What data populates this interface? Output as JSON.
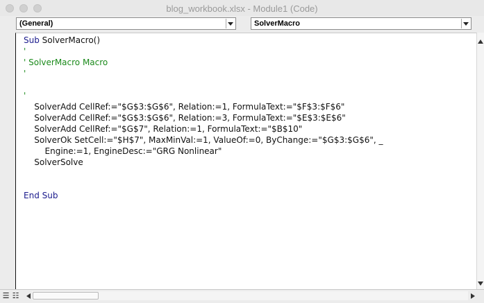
{
  "window": {
    "title": "blog_workbook.xlsx - Module1 (Code)"
  },
  "toolbar": {
    "object_dropdown": "(General)",
    "procedure_dropdown": "SolverMacro"
  },
  "code": [
    {
      "parts": [
        {
          "t": "Sub ",
          "c": "kw"
        },
        {
          "t": "SolverMacro()",
          "c": "tx"
        }
      ]
    },
    {
      "parts": [
        {
          "t": "'",
          "c": "cm"
        }
      ]
    },
    {
      "parts": [
        {
          "t": "' SolverMacro Macro",
          "c": "cm"
        }
      ]
    },
    {
      "parts": [
        {
          "t": "'",
          "c": "cm"
        }
      ]
    },
    {
      "parts": [
        {
          "t": "",
          "c": "tx"
        }
      ]
    },
    {
      "parts": [
        {
          "t": "'",
          "c": "cm"
        }
      ]
    },
    {
      "parts": [
        {
          "t": "    SolverAdd CellRef:=\"$G$3:$G$6\", Relation:=1, FormulaText:=\"$F$3:$F$6\"",
          "c": "tx"
        }
      ]
    },
    {
      "parts": [
        {
          "t": "    SolverAdd CellRef:=\"$G$3:$G$6\", Relation:=3, FormulaText:=\"$E$3:$E$6\"",
          "c": "tx"
        }
      ]
    },
    {
      "parts": [
        {
          "t": "    SolverAdd CellRef:=\"$G$7\", Relation:=1, FormulaText:=\"$B$10\"",
          "c": "tx"
        }
      ]
    },
    {
      "parts": [
        {
          "t": "    SolverOk SetCell:=\"$H$7\", MaxMinVal:=1, ValueOf:=0, ByChange:=\"$G$3:$G$6\", _",
          "c": "tx"
        }
      ]
    },
    {
      "parts": [
        {
          "t": "        Engine:=1, EngineDesc:=\"GRG Nonlinear\"",
          "c": "tx"
        }
      ]
    },
    {
      "parts": [
        {
          "t": "    SolverSolve",
          "c": "tx"
        }
      ]
    },
    {
      "parts": [
        {
          "t": "",
          "c": "tx"
        }
      ]
    },
    {
      "parts": [
        {
          "t": "",
          "c": "tx"
        }
      ]
    },
    {
      "parts": [
        {
          "t": "End Sub",
          "c": "kw"
        }
      ]
    }
  ]
}
